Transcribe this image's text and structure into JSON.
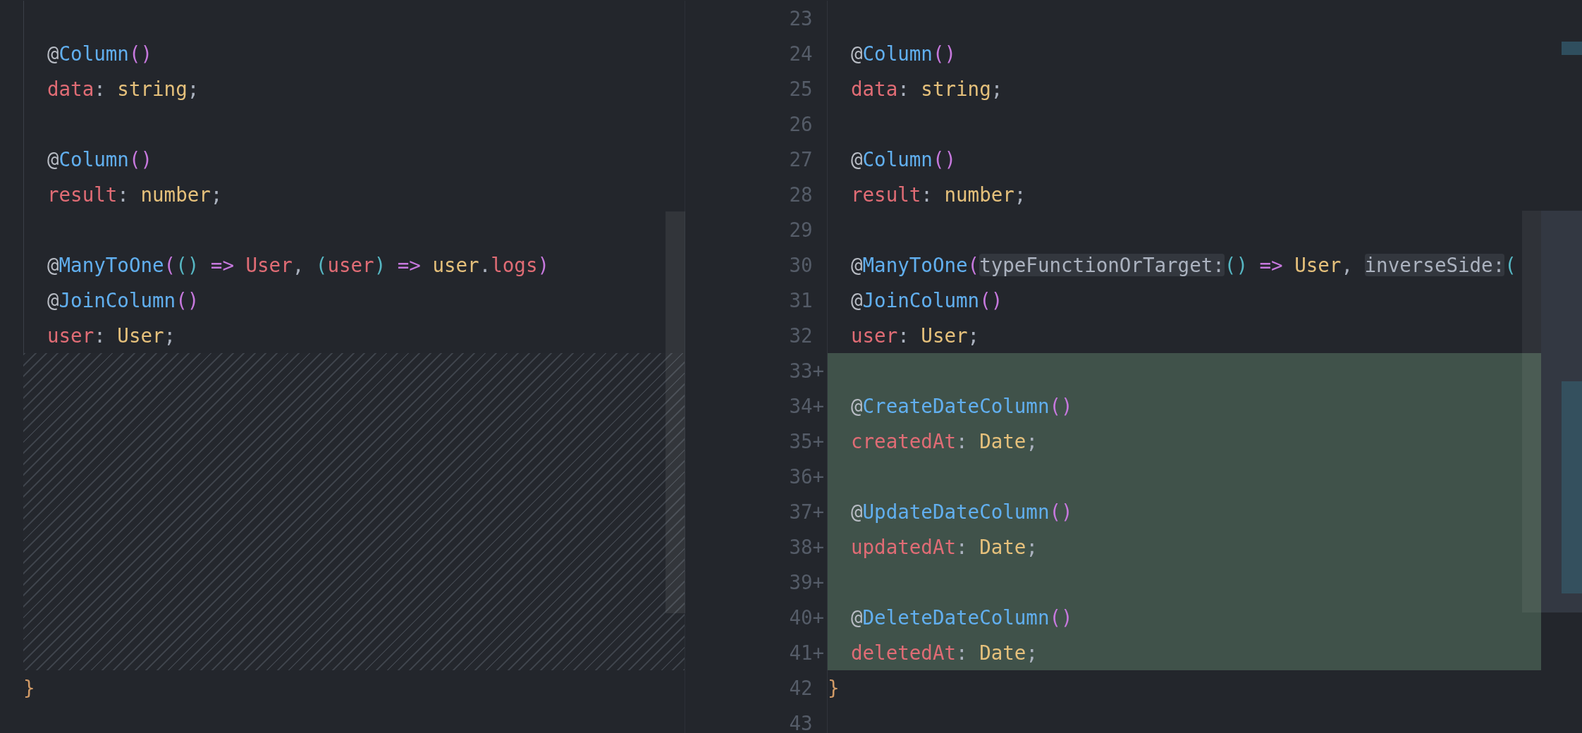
{
  "left_pane": {
    "lines": [
      {
        "kind": "code"
      },
      {
        "kind": "code",
        "tokens": [
          {
            "text": "@",
            "kind": "at"
          },
          {
            "text": "Column",
            "kind": "decorator"
          },
          {
            "text": "()",
            "kind": "paren"
          }
        ]
      },
      {
        "kind": "code",
        "tokens": [
          {
            "text": "data",
            "kind": "variable"
          },
          {
            "text": ": ",
            "kind": "punct"
          },
          {
            "text": "string",
            "kind": "type"
          },
          {
            "text": ";",
            "kind": "punct"
          }
        ]
      },
      {
        "kind": "code"
      },
      {
        "kind": "code",
        "tokens": [
          {
            "text": "@",
            "kind": "at"
          },
          {
            "text": "Column",
            "kind": "decorator"
          },
          {
            "text": "()",
            "kind": "paren"
          }
        ]
      },
      {
        "kind": "code",
        "tokens": [
          {
            "text": "result",
            "kind": "variable"
          },
          {
            "text": ": ",
            "kind": "punct"
          },
          {
            "text": "number",
            "kind": "type"
          },
          {
            "text": ";",
            "kind": "punct"
          }
        ]
      },
      {
        "kind": "code"
      },
      {
        "kind": "code",
        "tokens": [
          {
            "text": "@",
            "kind": "at"
          },
          {
            "text": "ManyToOne",
            "kind": "decorator"
          },
          {
            "text": "(",
            "kind": "paren"
          },
          {
            "text": "()",
            "kind": "paren2"
          },
          {
            "text": " => ",
            "kind": "arrow"
          },
          {
            "text": "User",
            "kind": "variable"
          },
          {
            "text": ", ",
            "kind": "punct"
          },
          {
            "text": "(",
            "kind": "paren2"
          },
          {
            "text": "user",
            "kind": "variable"
          },
          {
            "text": ")",
            "kind": "paren2"
          },
          {
            "text": " => ",
            "kind": "arrow"
          },
          {
            "text": "user",
            "kind": "type"
          },
          {
            "text": ".",
            "kind": "punct"
          },
          {
            "text": "logs",
            "kind": "variable"
          },
          {
            "text": ")",
            "kind": "paren"
          }
        ]
      },
      {
        "kind": "code",
        "tokens": [
          {
            "text": "@",
            "kind": "at"
          },
          {
            "text": "JoinColumn",
            "kind": "decorator"
          },
          {
            "text": "()",
            "kind": "paren"
          }
        ]
      },
      {
        "kind": "code",
        "tokens": [
          {
            "text": "user",
            "kind": "variable"
          },
          {
            "text": ": ",
            "kind": "punct"
          },
          {
            "text": "User",
            "kind": "type"
          },
          {
            "text": ";",
            "kind": "punct"
          }
        ]
      },
      {
        "kind": "gap"
      },
      {
        "kind": "code",
        "tokens": [
          {
            "text": "}",
            "kind": "brace"
          }
        ]
      },
      {
        "kind": "code"
      }
    ]
  },
  "right_pane": {
    "lines": [
      {
        "number": "23",
        "added": false
      },
      {
        "number": "24",
        "added": false,
        "tokens": [
          {
            "text": "@",
            "kind": "at"
          },
          {
            "text": "Column",
            "kind": "decorator"
          },
          {
            "text": "()",
            "kind": "paren"
          }
        ]
      },
      {
        "number": "25",
        "added": false,
        "tokens": [
          {
            "text": "data",
            "kind": "variable"
          },
          {
            "text": ": ",
            "kind": "punct"
          },
          {
            "text": "string",
            "kind": "type"
          },
          {
            "text": ";",
            "kind": "punct"
          }
        ]
      },
      {
        "number": "26",
        "added": false
      },
      {
        "number": "27",
        "added": false,
        "tokens": [
          {
            "text": "@",
            "kind": "at"
          },
          {
            "text": "Column",
            "kind": "decorator"
          },
          {
            "text": "()",
            "kind": "paren"
          }
        ]
      },
      {
        "number": "28",
        "added": false,
        "tokens": [
          {
            "text": "result",
            "kind": "variable"
          },
          {
            "text": ": ",
            "kind": "punct"
          },
          {
            "text": "number",
            "kind": "type"
          },
          {
            "text": ";",
            "kind": "punct"
          }
        ]
      },
      {
        "number": "29",
        "added": false
      },
      {
        "number": "30",
        "added": false,
        "tokens": [
          {
            "text": "@",
            "kind": "at"
          },
          {
            "text": "ManyToOne",
            "kind": "decorator"
          },
          {
            "text": "(",
            "kind": "paren"
          },
          {
            "text": "typeFunctionOrTarget:",
            "kind": "hint"
          },
          {
            "text": "()",
            "kind": "paren2"
          },
          {
            "text": " => ",
            "kind": "arrow"
          },
          {
            "text": "User",
            "kind": "type"
          },
          {
            "text": ", ",
            "kind": "punct"
          },
          {
            "text": "inverseSide:",
            "kind": "hint"
          },
          {
            "text": "(",
            "kind": "paren2"
          }
        ]
      },
      {
        "number": "31",
        "added": false,
        "tokens": [
          {
            "text": "@",
            "kind": "at"
          },
          {
            "text": "JoinColumn",
            "kind": "decorator"
          },
          {
            "text": "()",
            "kind": "paren"
          }
        ]
      },
      {
        "number": "32",
        "added": false,
        "tokens": [
          {
            "text": "user",
            "kind": "variable"
          },
          {
            "text": ": ",
            "kind": "punct"
          },
          {
            "text": "User",
            "kind": "type"
          },
          {
            "text": ";",
            "kind": "punct"
          }
        ]
      },
      {
        "number": "33",
        "marker": "+",
        "added": true
      },
      {
        "number": "34",
        "marker": "+",
        "added": true,
        "tokens": [
          {
            "text": "@",
            "kind": "at"
          },
          {
            "text": "CreateDateColumn",
            "kind": "decorator"
          },
          {
            "text": "()",
            "kind": "paren"
          }
        ]
      },
      {
        "number": "35",
        "marker": "+",
        "added": true,
        "tokens": [
          {
            "text": "createdAt",
            "kind": "variable"
          },
          {
            "text": ": ",
            "kind": "punct"
          },
          {
            "text": "Date",
            "kind": "type"
          },
          {
            "text": ";",
            "kind": "punct"
          }
        ]
      },
      {
        "number": "36",
        "marker": "+",
        "added": true
      },
      {
        "number": "37",
        "marker": "+",
        "added": true,
        "tokens": [
          {
            "text": "@",
            "kind": "at"
          },
          {
            "text": "UpdateDateColumn",
            "kind": "decorator"
          },
          {
            "text": "()",
            "kind": "paren"
          }
        ]
      },
      {
        "number": "38",
        "marker": "+",
        "added": true,
        "tokens": [
          {
            "text": "updatedAt",
            "kind": "variable"
          },
          {
            "text": ": ",
            "kind": "punct"
          },
          {
            "text": "Date",
            "kind": "type"
          },
          {
            "text": ";",
            "kind": "punct"
          }
        ]
      },
      {
        "number": "39",
        "marker": "+",
        "added": true
      },
      {
        "number": "40",
        "marker": "+",
        "added": true,
        "tokens": [
          {
            "text": "@",
            "kind": "at"
          },
          {
            "text": "DeleteDateColumn",
            "kind": "decorator"
          },
          {
            "text": "()",
            "kind": "paren"
          }
        ]
      },
      {
        "number": "41",
        "marker": "+",
        "added": true,
        "tokens": [
          {
            "text": "deletedAt",
            "kind": "variable"
          },
          {
            "text": ": ",
            "kind": "punct"
          },
          {
            "text": "Date",
            "kind": "type"
          },
          {
            "text": ";",
            "kind": "punct"
          }
        ]
      },
      {
        "number": "42",
        "added": false,
        "tokens": [
          {
            "text": "}",
            "kind": "brace"
          }
        ]
      },
      {
        "number": "43",
        "added": false
      }
    ]
  }
}
